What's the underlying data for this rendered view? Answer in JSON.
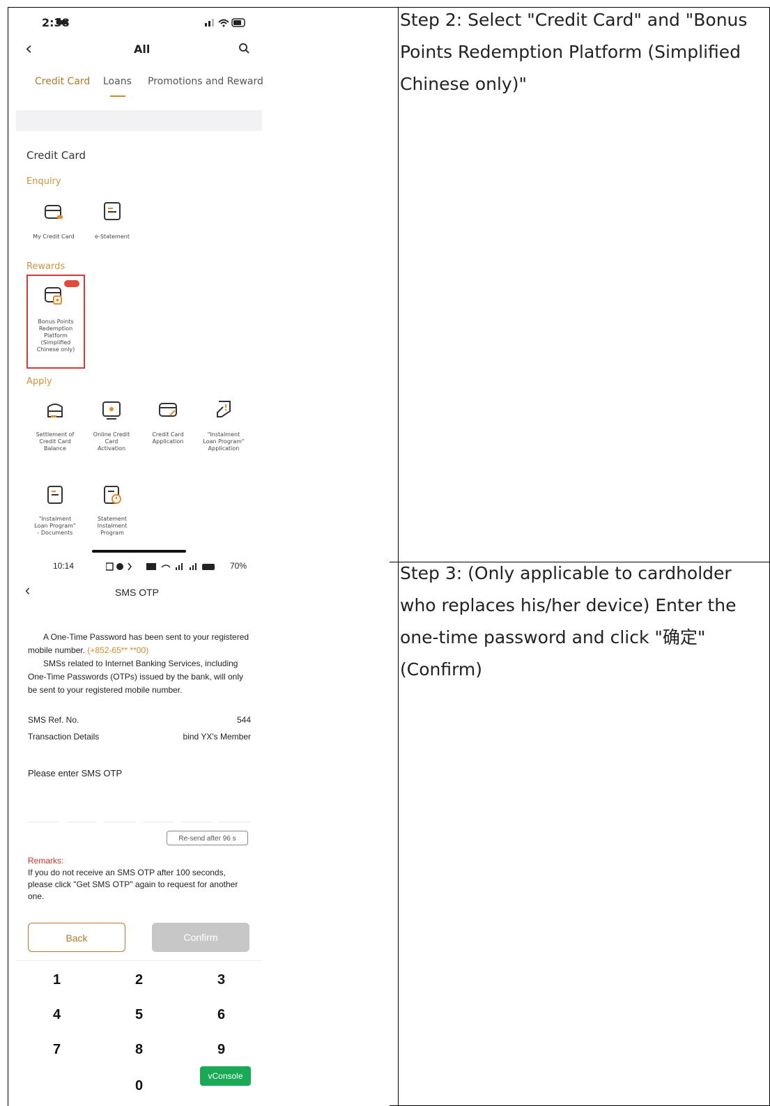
{
  "steps": [
    {
      "text": "Step 2: Select \"Credit Card\" and \"Bonus Points Redemption Platform (Simplified Chinese only)\""
    },
    {
      "text": "Step 3: (Only applicable to cardholder who replaces his/her device) Enter the one-time password and click \"确定\" (Confirm)"
    }
  ],
  "phone1": {
    "status": {
      "time": "2:38"
    },
    "header": {
      "title": "All"
    },
    "tabs": [
      {
        "label": "Credit Card",
        "active": true
      },
      {
        "label": "Loans",
        "active": false
      },
      {
        "label": "Promotions and Reward",
        "active": false
      }
    ],
    "section_title": "Credit Card",
    "groups": {
      "enquiry": "Enquiry",
      "rewards": "Rewards",
      "apply": "Apply"
    },
    "items": {
      "my_credit_card": "My Credit Card",
      "e_statement": "e-Statement",
      "bonus_points": "Bonus Points Redemption Platform (Simplified Chinese only)",
      "settlement": "Settlement of Credit Card Balance",
      "online_activation": "Online Credit Card Activation",
      "card_application": "Credit Card Application",
      "instalment_application": "\"Instalment Loan Program\" Application",
      "instalment_documents": "\"Instalment Loan Program\" - Documents",
      "statement_instalment": "Statement Instalment Program"
    },
    "highlight_color": "#d23a3a",
    "accent_color": "#c9953f"
  },
  "phone2": {
    "status": {
      "time": "10:14",
      "battery": "70%"
    },
    "header": {
      "title": "SMS OTP"
    },
    "message_1": "A One-Time Password has been sent to your registered mobile number.",
    "masked_number": "(+852-65** **00)",
    "message_2": "SMSs related to Internet Banking Services, including One-Time Passwords (OTPs) issued by the bank, will only be sent to your registered mobile number.",
    "sms_ref_label": "SMS Ref. No.",
    "sms_ref_value": "544",
    "txn_label": "Transaction Details",
    "txn_value": "bind YX's Member",
    "enter_otp": "Please enter SMS OTP",
    "resend": "Re-send after 96 s",
    "remarks_title": "Remarks:",
    "remarks_text": "If you do not receive an SMS OTP after 100 seconds, please click \"Get SMS OTP\" again to request for another one.",
    "back_button": "Back",
    "confirm_button": "Confirm",
    "keypad": [
      "1",
      "2",
      "3",
      "4",
      "5",
      "6",
      "7",
      "8",
      "9",
      "0"
    ],
    "vconsole": "vConsole"
  }
}
